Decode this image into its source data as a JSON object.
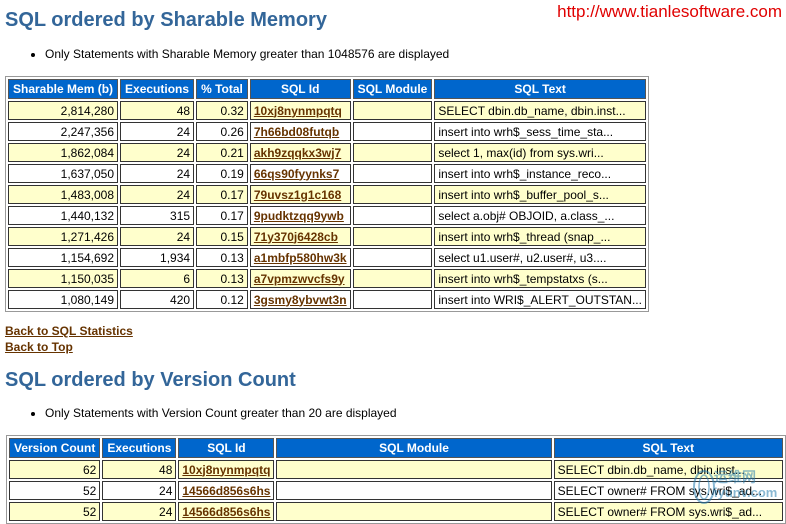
{
  "watermark": "http://www.tianlesoftware.com",
  "section1": {
    "title": "SQL ordered by Sharable Memory",
    "note": "Only Statements with Sharable Memory greater than 1048576 are displayed",
    "headers": [
      "Sharable Mem (b)",
      "Executions",
      "% Total",
      "SQL Id",
      "SQL Module",
      "SQL Text"
    ],
    "rows": [
      [
        "2,814,280",
        "48",
        "0.32",
        "10xj8nynmpqtq",
        "",
        "SELECT dbin.db_name, dbin.inst..."
      ],
      [
        "2,247,356",
        "24",
        "0.26",
        "7h66bd08futqb",
        "",
        "insert into wrh$_sess_time_sta..."
      ],
      [
        "1,862,084",
        "24",
        "0.21",
        "akh9zqqkx3wj7",
        "",
        "select 1, max(id) from sys.wri..."
      ],
      [
        "1,637,050",
        "24",
        "0.19",
        "66qs90fyynks7",
        "",
        "insert into wrh$_instance_reco..."
      ],
      [
        "1,483,008",
        "24",
        "0.17",
        "79uvsz1g1c168",
        "",
        "insert into wrh$_buffer_pool_s..."
      ],
      [
        "1,440,132",
        "315",
        "0.17",
        "9pudktzqq9ywb",
        "",
        "select a.obj# OBJOID, a.class_..."
      ],
      [
        "1,271,426",
        "24",
        "0.15",
        "71y370j6428cb",
        "",
        "insert into wrh$_thread (snap_..."
      ],
      [
        "1,154,692",
        "1,934",
        "0.13",
        "a1mbfp580hw3k",
        "",
        "select u1.user#, u2.user#, u3...."
      ],
      [
        "1,150,035",
        "6",
        "0.13",
        "a7vpmzwvcfs9y",
        "",
        "insert into wrh$_tempstatxs (s..."
      ],
      [
        "1,080,149",
        "420",
        "0.12",
        "3gsmy8ybvwt3n",
        "",
        "insert into WRI$_ALERT_OUTSTAN..."
      ]
    ]
  },
  "links": {
    "back_sql_stats": "Back to SQL Statistics",
    "back_top": "Back to Top"
  },
  "section2": {
    "title": "SQL ordered by Version Count",
    "note": "Only Statements with Version Count greater than 20 are displayed",
    "headers": [
      "Version Count",
      "Executions",
      "SQL Id",
      "SQL Module",
      "SQL Text"
    ],
    "rows": [
      [
        "62",
        "48",
        "10xj8nynmpqtq",
        "",
        "SELECT dbin.db_name, dbin.inst..."
      ],
      [
        "52",
        "24",
        "14566d856s6hs",
        "",
        "SELECT owner# FROM sys.wri$_ad..."
      ],
      [
        "52",
        "24",
        "14566d856s6hs",
        "",
        "SELECT owner# FROM sys.wri$_ad..."
      ]
    ]
  },
  "logo": {
    "cn": "运维网",
    "en": "iyunv.com"
  }
}
